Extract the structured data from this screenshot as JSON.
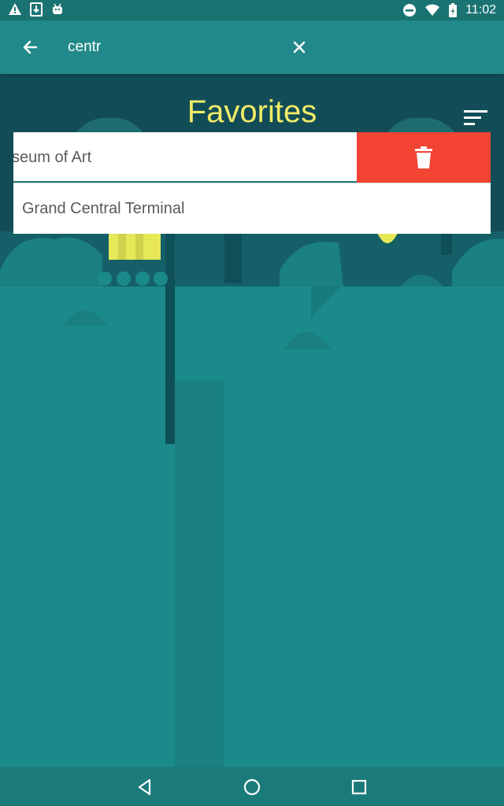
{
  "status_bar": {
    "time": "11:02",
    "left_icons": [
      "warning-icon",
      "download-icon",
      "android-icon"
    ],
    "right_icons": [
      "do-not-disturb-icon",
      "wifi-icon",
      "battery-charging-icon"
    ]
  },
  "app_bar": {
    "search_value": "centr",
    "back_icon": "arrow-left-icon",
    "clear_icon": "close-icon"
  },
  "page": {
    "title": "Favorites",
    "sort_icon": "sort-icon"
  },
  "favorites": [
    {
      "label": "seum of Art",
      "swiped": true,
      "action_icon": "trash-icon"
    },
    {
      "label": "Grand Central Terminal",
      "swiped": false
    }
  ],
  "nav_bar": {
    "icons": [
      "back-triangle-icon",
      "home-circle-icon",
      "recents-square-icon"
    ]
  },
  "colors": {
    "app_bar": "#22898a",
    "status_bar": "#1a7373",
    "background": "#1b8a8a",
    "title": "#f2ec68",
    "delete": "#f24333"
  }
}
